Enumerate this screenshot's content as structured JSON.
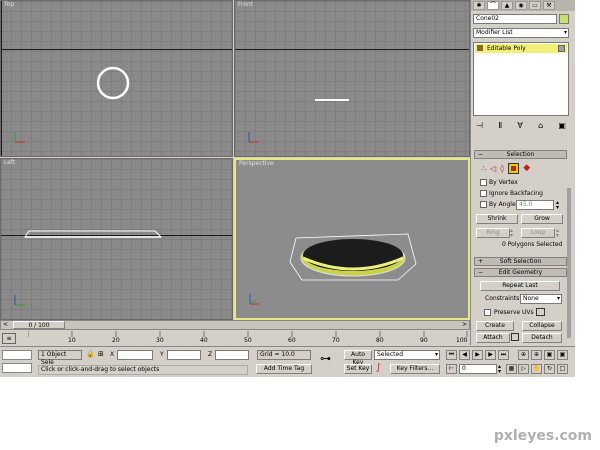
{
  "viewports": {
    "top": {
      "label": "Top"
    },
    "front": {
      "label": "Front"
    },
    "left": {
      "label": "Left"
    },
    "perspective": {
      "label": "Perspective"
    }
  },
  "command_panel": {
    "object_name": "Cone02",
    "modifier_list": "Modifier List",
    "stack_item": "Editable Poly",
    "selection": {
      "title": "Selection",
      "by_vertex": "By Vertex",
      "ignore_backfacing": "Ignore Backfacing",
      "by_angle": "By Angle:",
      "angle_value": "45.0",
      "shrink": "Shrink",
      "grow": "Grow",
      "ring": "Ring",
      "loop": "Loop",
      "status": "0 Polygons Selected"
    },
    "soft_selection": "Soft Selection",
    "edit_geometry": {
      "title": "Edit Geometry",
      "repeat_last": "Repeat Last",
      "constraints_label": "Constraints:",
      "constraints_value": "None",
      "preserve_uvs": "Preserve UVs",
      "create": "Create",
      "collapse": "Collapse",
      "attach": "Attach",
      "detach": "Detach"
    }
  },
  "timeline": {
    "frame": "0 / 100",
    "ticks": [
      "10",
      "20",
      "30",
      "40",
      "50",
      "60",
      "70",
      "80",
      "90",
      "100"
    ]
  },
  "status": {
    "selection_count": "1 Object Sele",
    "x_label": "X",
    "y_label": "Y",
    "z_label": "Z",
    "grid": "Grid = 10.0",
    "auto_key": "Auto Key",
    "set_key": "Set Key",
    "key_mode": "Selected",
    "key_filters": "Key Filters...",
    "prompt": "Click or click-and-drag to select objects",
    "add_time_tag": "Add Time Tag",
    "frame_field": "0"
  },
  "watermark": "pxleyes.com",
  "colors": {
    "active_border": "#e8e880",
    "object_fill": "#c8d24a",
    "stack_highlight": "#f2f078"
  }
}
